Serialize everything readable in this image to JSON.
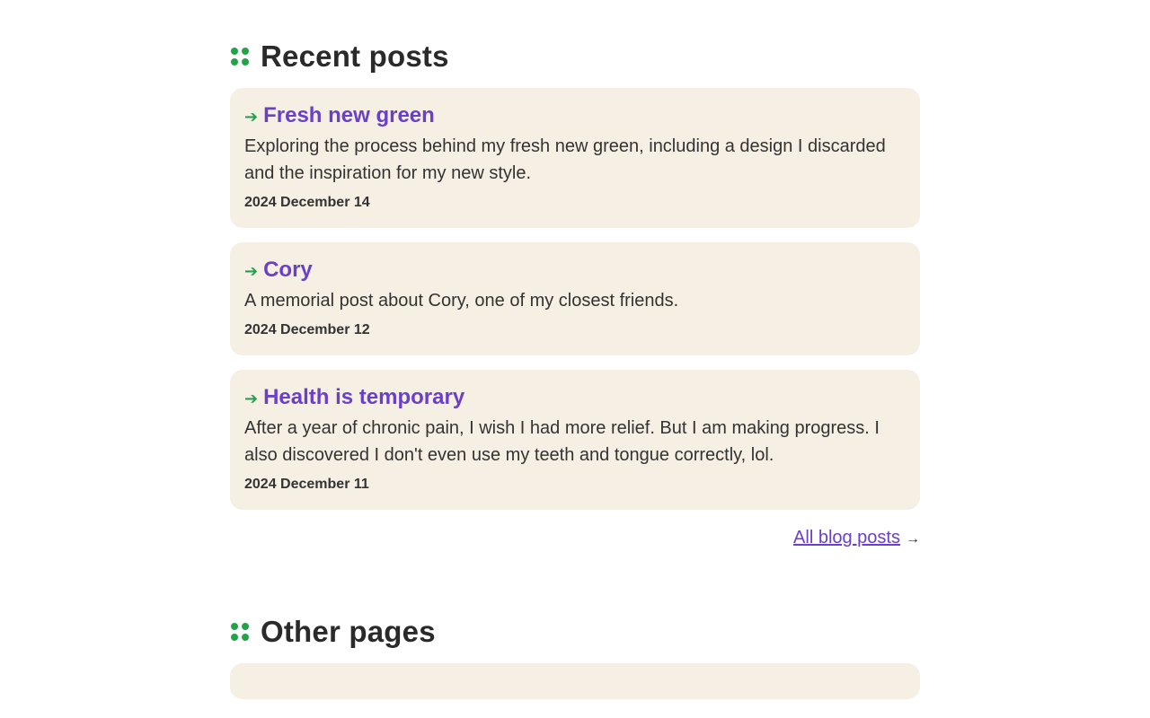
{
  "recent": {
    "heading": "Recent posts",
    "posts": [
      {
        "title": "Fresh new green",
        "excerpt": "Exploring the process behind my fresh new green, including a design I discarded and the inspiration for my new style.",
        "date": "2024 December 14"
      },
      {
        "title": "Cory",
        "excerpt": "A memorial post about Cory, one of my closest friends.",
        "date": "2024 December 12"
      },
      {
        "title": "Health is temporary",
        "excerpt": "After a year of chronic pain, I wish I had more relief. But I am making progress. I also discovered I don't even use my teeth and tongue correctly, lol.",
        "date": "2024 December 11"
      }
    ],
    "all_posts_label": "All blog posts",
    "arrow": "→"
  },
  "other": {
    "heading": "Other pages"
  },
  "icons": {
    "heading_marker": "four-dots-icon",
    "post_arrow": "arrow-right-icon"
  },
  "colors": {
    "accent_green": "#22a34a",
    "link_purple": "#6a3fc9",
    "card_bg": "#f6efe3"
  }
}
